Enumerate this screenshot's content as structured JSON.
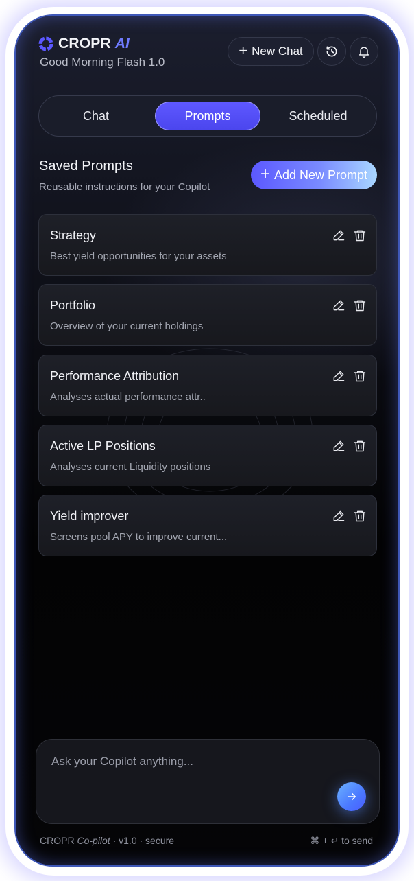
{
  "header": {
    "brand": "CROPR",
    "brand_suffix": "AI",
    "greeting": "Good Morning Flash 1.0",
    "new_chat_label": "New Chat",
    "icons": [
      "cropr-logo-icon",
      "history-icon",
      "bell-icon"
    ],
    "accent_color": "#6f7bff"
  },
  "tabs": [
    {
      "label": "Chat",
      "active": false
    },
    {
      "label": "Prompts",
      "active": true
    },
    {
      "label": "Scheduled",
      "active": false
    }
  ],
  "saved_prompts": {
    "title": "Saved Prompts",
    "subtitle": "Reusable instructions for your Copilot",
    "add_label": "Add New Prompt",
    "items": [
      {
        "title": "Strategy",
        "description": "Best yield opportunities for your assets"
      },
      {
        "title": "Portfolio",
        "description": "Overview of your current holdings"
      },
      {
        "title": "Performance Attribution",
        "description": "Analyses actual performance attr.."
      },
      {
        "title": "Active LP Positions",
        "description": "Analyses current Liquidity positions"
      },
      {
        "title": "Yield improver",
        "description": "Screens pool APY to improve current..."
      }
    ],
    "item_icons": [
      "pencil-icon",
      "trash-icon"
    ]
  },
  "composer": {
    "placeholder": "Ask your Copilot anything...",
    "send_icon": "arrow-right-icon"
  },
  "footer": {
    "brand": "CROPR",
    "product": "Co-pilot",
    "meta": "· v1.0 · secure",
    "shortcut": "⌘ + ↵ to send"
  }
}
